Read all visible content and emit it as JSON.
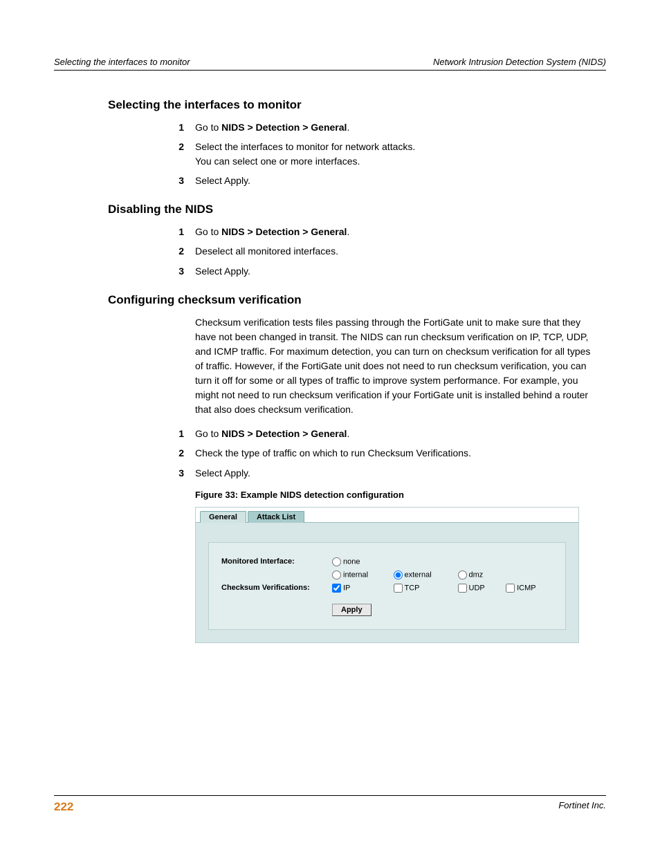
{
  "header": {
    "left": "Selecting the interfaces to monitor",
    "right": "Network Intrusion Detection System (NIDS)"
  },
  "sections": {
    "s1": {
      "title": "Selecting the interfaces to monitor",
      "step1_pre": "Go to ",
      "step1_bold": "NIDS > Detection > General",
      "step1_post": ".",
      "step2a": "Select the interfaces to monitor for network attacks.",
      "step2b": "You can select one or more interfaces.",
      "step3": "Select Apply."
    },
    "s2": {
      "title": "Disabling the NIDS",
      "step1_pre": "Go to ",
      "step1_bold": "NIDS > Detection > General",
      "step1_post": ".",
      "step2": "Deselect all monitored interfaces.",
      "step3": "Select Apply."
    },
    "s3": {
      "title": "Configuring checksum verification",
      "para": "Checksum verification tests files passing through the FortiGate unit to make sure that they have not been changed in transit. The NIDS can run checksum verification on IP, TCP, UDP, and ICMP traffic. For maximum detection, you can turn on checksum verification for all types of traffic. However, if the FortiGate unit does not need to run checksum verification, you can turn it off for some or all types of traffic to improve system performance. For example, you might not need to run checksum verification if your FortiGate unit is installed behind a router that also does checksum verification.",
      "step1_pre": "Go to ",
      "step1_bold": "NIDS > Detection > General",
      "step1_post": ".",
      "step2": "Check the type of traffic on which to run Checksum Verifications.",
      "step3": "Select Apply."
    }
  },
  "figure": {
    "caption": "Figure 33: Example NIDS detection configuration",
    "tabs": {
      "general": "General",
      "attack": "Attack List"
    },
    "labels": {
      "monitored": "Monitored Interface:",
      "checksum": "Checksum Verifications:"
    },
    "radios": {
      "none": "none",
      "internal": "internal",
      "external": "external",
      "dmz": "dmz"
    },
    "checks": {
      "ip": "IP",
      "tcp": "TCP",
      "udp": "UDP",
      "icmp": "ICMP"
    },
    "apply": "Apply"
  },
  "footer": {
    "page": "222",
    "right": "Fortinet Inc."
  }
}
